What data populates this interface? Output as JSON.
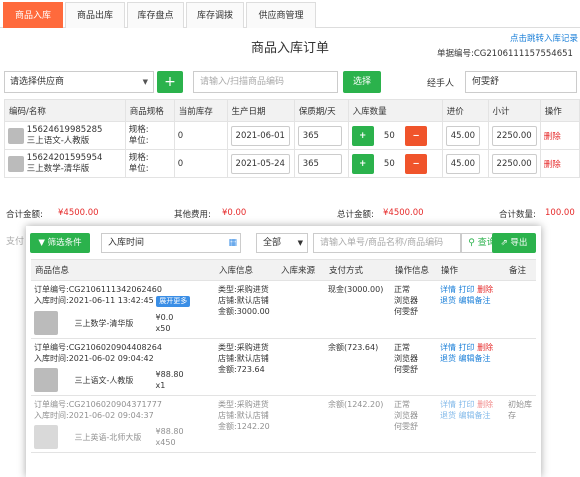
{
  "tabs": [
    "商品入库",
    "商品出库",
    "库存盘点",
    "库存调拨",
    "供应商管理"
  ],
  "page_title": "商品入库订单",
  "jump_link": "点击跳转入库记录",
  "doc_no_label": "单据编号:",
  "doc_no_value": "CG2106111157554651",
  "supplier_select": "请选择供应商",
  "plus_label": "+",
  "minus_label": "−",
  "scan_placeholder": "请输入/扫描商品编码",
  "choose_button": "选择",
  "handler_label": "经手人",
  "handler_value": "何雯舒",
  "columns": [
    "编码/名称",
    "商品规格",
    "当前库存",
    "生产日期",
    "保质期/天",
    "入库数量",
    "进价",
    "小计",
    "操作"
  ],
  "rows": [
    {
      "code": "15624619985285",
      "name": "三上语文-人教版",
      "spec1": "规格:",
      "spec2": "单位:",
      "stock": "0",
      "date": "2021-06-01",
      "shelf": "365",
      "qty": "50",
      "price": "45.00",
      "subtotal": "2250.00",
      "op": "删除"
    },
    {
      "code": "15624201595954",
      "name": "三上数学-清华版",
      "spec1": "规格:",
      "spec2": "单位:",
      "stock": "0",
      "date": "2021-05-24",
      "shelf": "365",
      "qty": "50",
      "price": "45.00",
      "subtotal": "2250.00",
      "op": "删除"
    }
  ],
  "totals": {
    "sum_label": "合计金额:",
    "sum_value": "¥4500.00",
    "other_label": "其他费用:",
    "other_value": "¥0.00",
    "total_label": "总计金额:",
    "total_value": "¥4500.00",
    "count_label": "合计数量:",
    "count_value": "100.00"
  },
  "pay_partial": "支付",
  "overlay": {
    "filter_button": "筛选条件",
    "time_label": "入库时间",
    "all_select": "全部",
    "search_placeholder": "请输入单号/商品名称/商品编码",
    "search_button": "查询",
    "export_button": "导出",
    "columns": [
      "商品信息",
      "入库信息",
      "入库来源",
      "支付方式",
      "操作信息",
      "操作",
      "备注"
    ],
    "records": [
      {
        "order": "订单编号:CG2106111342062460",
        "time": "入库时间:2021-06-11 13:42:45",
        "expand": "展开更多",
        "product": "三上数学-清华版",
        "price": "¥0.0",
        "qty": "x50",
        "info1": "类型:采购进货",
        "info2": "店铺:默认店铺",
        "info3": "金额:3000.00",
        "pay": "现金(3000.00)",
        "s1": "正常",
        "s2": "浏览器",
        "s3": "何雯舒",
        "a1": "详情",
        "a2": "打印",
        "a3": "删除",
        "a4": "退货",
        "a5": "编辑备注",
        "note": ""
      },
      {
        "order": "订单编号:CG2106020904408264",
        "time": "入库时间:2021-06-02 09:04:42",
        "expand": "",
        "product": "三上语文-人教版",
        "price": "¥88.80",
        "qty": "x1",
        "info1": "类型:采购进货",
        "info2": "店铺:默认店铺",
        "info3": "金额:723.64",
        "pay": "余额(723.64)",
        "s1": "正常",
        "s2": "浏览器",
        "s3": "何雯舒",
        "a1": "详情",
        "a2": "打印",
        "a3": "删除",
        "a4": "退货",
        "a5": "编辑备注",
        "note": ""
      },
      {
        "order": "订单编号:CG2106020904371777",
        "time": "入库时间:2021-06-02 09:04:37",
        "expand": "",
        "product": "三上英语-北师大版",
        "price": "¥88.80",
        "qty": "x450",
        "info1": "类型:采购进货",
        "info2": "店铺:默认店铺",
        "info3": "金额:1242.20",
        "pay": "余额(1242.20)",
        "s1": "正常",
        "s2": "浏览器",
        "s3": "何雯舒",
        "a1": "详情",
        "a2": "打印",
        "a3": "删除",
        "a4": "退货",
        "a5": "编辑备注",
        "note": "初始库存"
      }
    ]
  }
}
